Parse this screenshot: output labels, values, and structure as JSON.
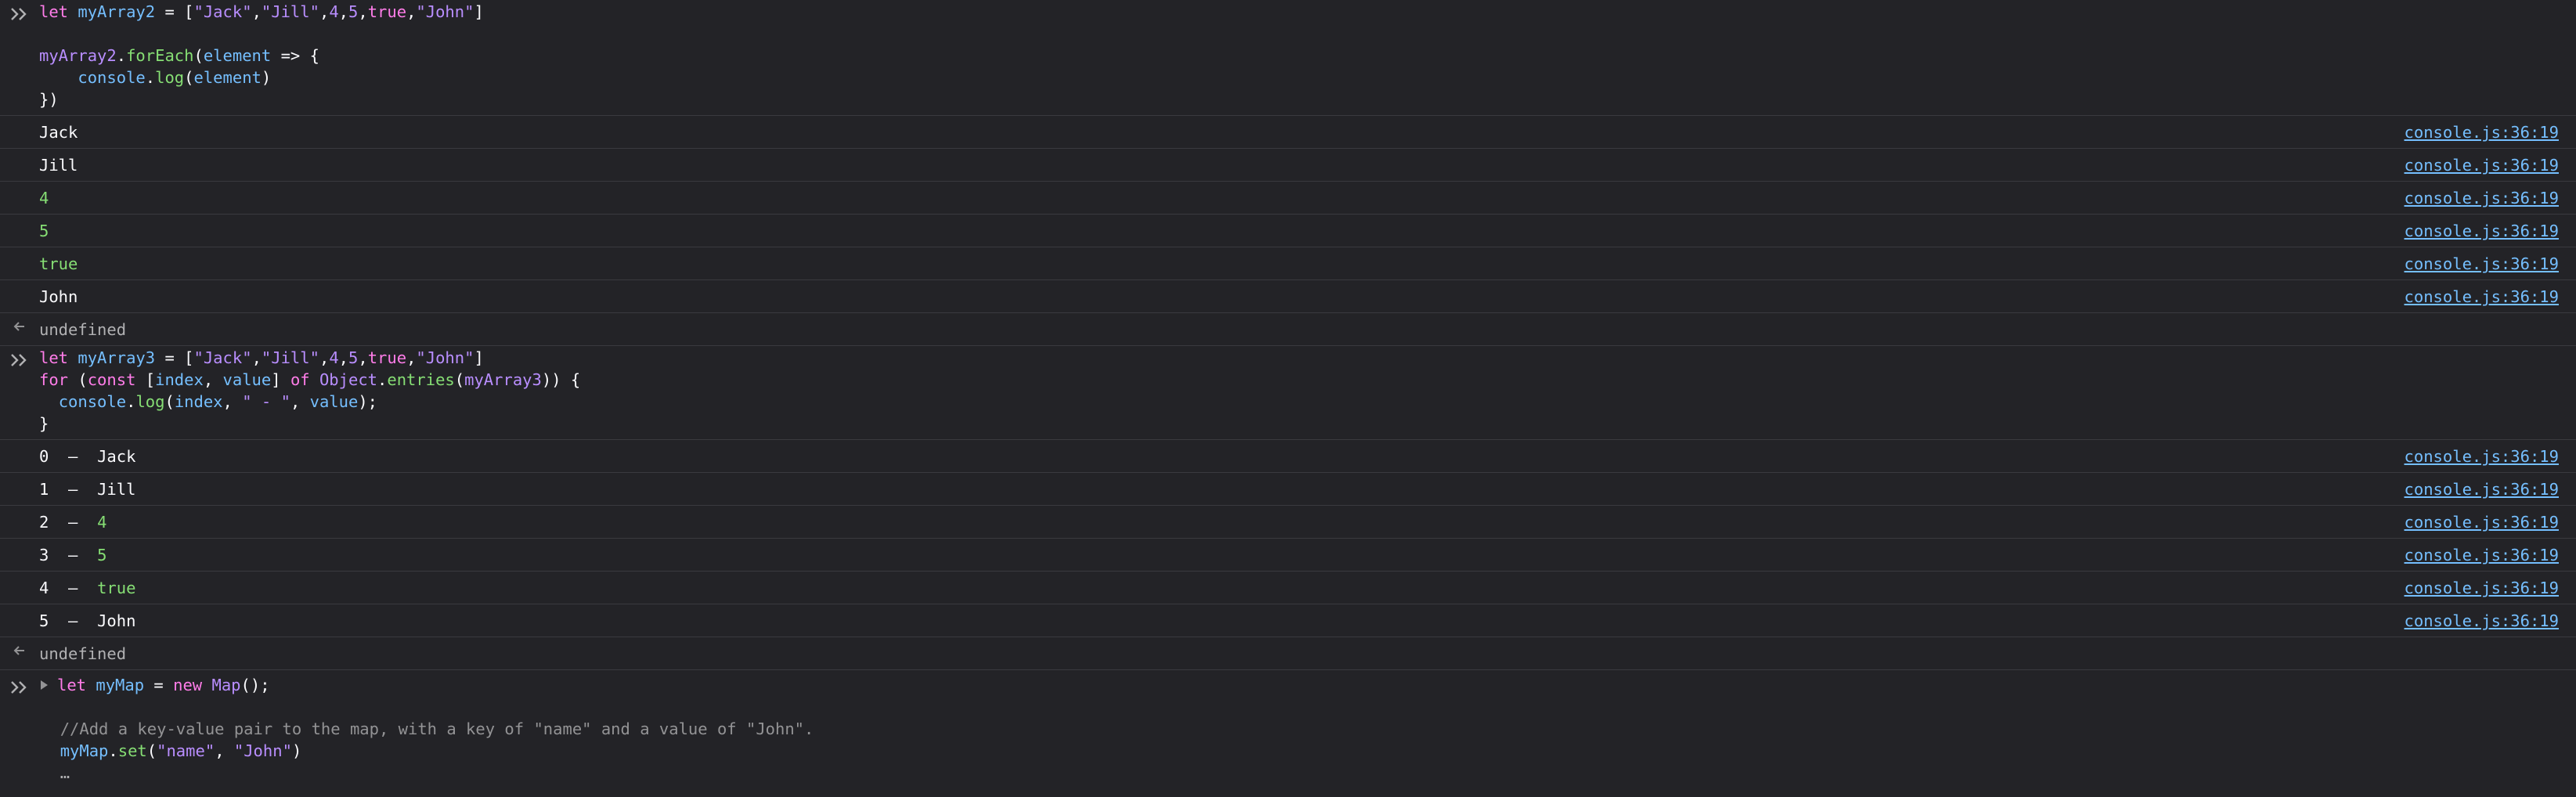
{
  "block1": {
    "code_lines": [
      [
        "let ",
        "myArray2",
        " = [",
        "\"Jack\"",
        ",",
        "\"Jill\"",
        ",",
        "4",
        ",",
        "5",
        ",",
        "true",
        ",",
        "\"John\"",
        "]"
      ],
      [],
      [
        "myArray2",
        ".",
        "forEach",
        "(",
        "element",
        " => {"
      ],
      [
        "    console",
        ".",
        "log",
        "(",
        "element",
        ")"
      ],
      [
        "})"
      ]
    ],
    "l1": {
      "kw": "let",
      "var": "myArray2",
      "eq": " = [",
      "s1": "\"Jack\"",
      "c1": ",",
      "s2": "\"Jill\"",
      "c2": ",",
      "n1": "4",
      "c3": ",",
      "n2": "5",
      "c4": ",",
      "b1": "true",
      "c5": ",",
      "s3": "\"John\"",
      "end": "]"
    },
    "l3": {
      "obj": "myArray2",
      "dot": ".",
      "fn": "forEach",
      "p1": "(",
      "arg": "element",
      "rest": " => {"
    },
    "l4": {
      "indent": "    ",
      "obj": "console",
      "dot": ".",
      "fn": "log",
      "p1": "(",
      "arg": "element",
      "p2": ")"
    },
    "l5": "})",
    "logs": [
      {
        "text": "Jack",
        "color": "plain",
        "source": "console.js:36:19"
      },
      {
        "text": "Jill",
        "color": "plain",
        "source": "console.js:36:19"
      },
      {
        "text": "4",
        "color": "green",
        "source": "console.js:36:19"
      },
      {
        "text": "5",
        "color": "green",
        "source": "console.js:36:19"
      },
      {
        "text": "true",
        "color": "green",
        "source": "console.js:36:19"
      },
      {
        "text": "John",
        "color": "plain",
        "source": "console.js:36:19"
      }
    ],
    "result": "undefined"
  },
  "block2": {
    "l1": {
      "kw": "let",
      "var": "myArray3",
      "eq": " = [",
      "s1": "\"Jack\"",
      "c1": ",",
      "s2": "\"Jill\"",
      "c2": ",",
      "n1": "4",
      "c3": ",",
      "n2": "5",
      "c4": ",",
      "b1": "true",
      "c5": ",",
      "s3": "\"John\"",
      "end": "]"
    },
    "l2": {
      "kw1": "for",
      "p1": " (",
      "kw2": "const",
      "b1": " [",
      "v1": "index",
      "c1": ", ",
      "v2": "value",
      "b2": "] ",
      "kw3": "of",
      "sp": " ",
      "obj": "Object",
      "dot": ".",
      "fn": "entries",
      "p2": "(",
      "arg": "myArray3",
      "p3": ")) {"
    },
    "l3": {
      "indent": "  ",
      "obj": "console",
      "dot": ".",
      "fn": "log",
      "p1": "(",
      "v1": "index",
      "c1": ", ",
      "s1": "\" - \"",
      "c2": ", ",
      "v2": "value",
      "end": ");"
    },
    "l4": "}",
    "logs": [
      {
        "index": "0",
        "sep": "  –  ",
        "text": "Jack",
        "color": "plain",
        "source": "console.js:36:19"
      },
      {
        "index": "1",
        "sep": "  –  ",
        "text": "Jill",
        "color": "plain",
        "source": "console.js:36:19"
      },
      {
        "index": "2",
        "sep": "  –  ",
        "text": "4",
        "color": "green",
        "source": "console.js:36:19"
      },
      {
        "index": "3",
        "sep": "  –  ",
        "text": "5",
        "color": "green",
        "source": "console.js:36:19"
      },
      {
        "index": "4",
        "sep": "  –  ",
        "text": "true",
        "color": "green",
        "source": "console.js:36:19"
      },
      {
        "index": "5",
        "sep": "  –  ",
        "text": "John",
        "color": "plain",
        "source": "console.js:36:19"
      }
    ],
    "result": "undefined"
  },
  "block3": {
    "l1": {
      "kw": "let",
      "var": "myMap",
      "eq": " = ",
      "kw2": "new",
      "sp": " ",
      "cls": "Map",
      "end": "();"
    },
    "l3": "//Add a key-value pair to the map, with a key of \"name\" and a value of \"John\".",
    "l4": {
      "obj": "myMap",
      "dot": ".",
      "fn": "set",
      "p1": "(",
      "s1": "\"name\"",
      "c1": ", ",
      "s2": "\"John\"",
      "end": ")"
    },
    "l5": "…"
  },
  "icons": {
    "prompt": "double-chevron-right-icon",
    "result": "arrow-left-icon",
    "expand": "triangle-right-icon"
  },
  "colors": {
    "background": "#232327",
    "keyword": "#ff7de9",
    "variable": "#75bfff",
    "function": "#b98eff",
    "number": "#86de74",
    "link": "#75bfff",
    "comment": "#939395"
  }
}
